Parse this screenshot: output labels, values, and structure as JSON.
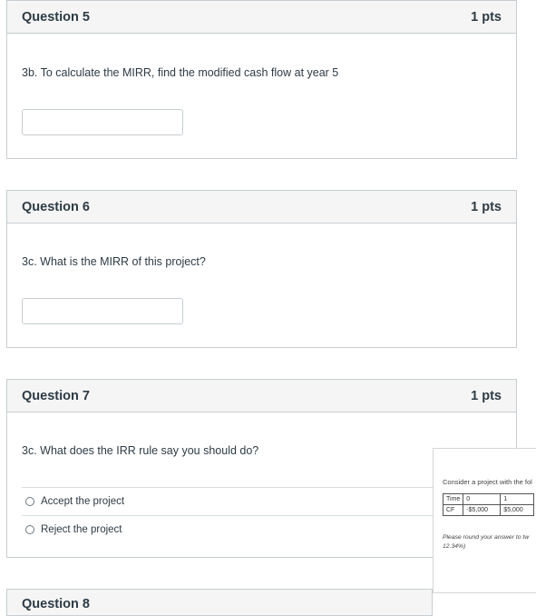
{
  "questions": [
    {
      "title": "Question 5",
      "points": "1 pts",
      "text": "3b. To calculate the MIRR, find the modified cash flow at year 5",
      "answer_value": ""
    },
    {
      "title": "Question 6",
      "points": "1 pts",
      "text": "3c. What is the MIRR of this project?",
      "answer_value": ""
    },
    {
      "title": "Question 7",
      "points": "1 pts",
      "text": "3c. What does the IRR rule say you should do?",
      "options": [
        "Accept the project",
        "Reject the project"
      ]
    }
  ],
  "next_question_title": "Question 8",
  "popup": {
    "intro": "Consider a project with the fol",
    "table": {
      "row1": [
        "Time",
        "0",
        "1"
      ],
      "row2": [
        "CF",
        "-$5,000",
        "$5,000"
      ]
    },
    "note_line1": "Please round your answer to tw",
    "note_line2": "12.34%)"
  }
}
